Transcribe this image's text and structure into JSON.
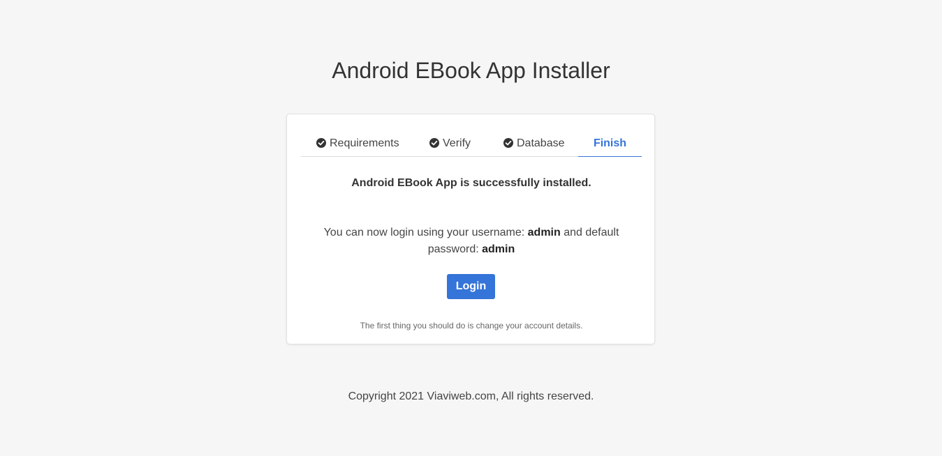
{
  "header": {
    "title": "Android EBook App Installer"
  },
  "tabs": [
    {
      "label": "Requirements",
      "icon": "check-circle-icon",
      "completed": true
    },
    {
      "label": "Verify",
      "icon": "check-circle-icon",
      "completed": true
    },
    {
      "label": "Database",
      "icon": "check-circle-icon",
      "completed": true
    },
    {
      "label": "Finish",
      "active": true
    }
  ],
  "content": {
    "success_message": "Android EBook App is successfully installed.",
    "login_text_prefix": "You can now login using your username:",
    "username": "admin",
    "login_text_middle": "and default password:",
    "password": "admin",
    "login_button": "Login",
    "hint": "The first thing you should do is change your account details."
  },
  "footer": {
    "copyright": "Copyright 2021 Viaviweb.com, All rights reserved."
  },
  "colors": {
    "accent": "#3574d8",
    "background": "#f6f6f6",
    "card": "#ffffff"
  }
}
